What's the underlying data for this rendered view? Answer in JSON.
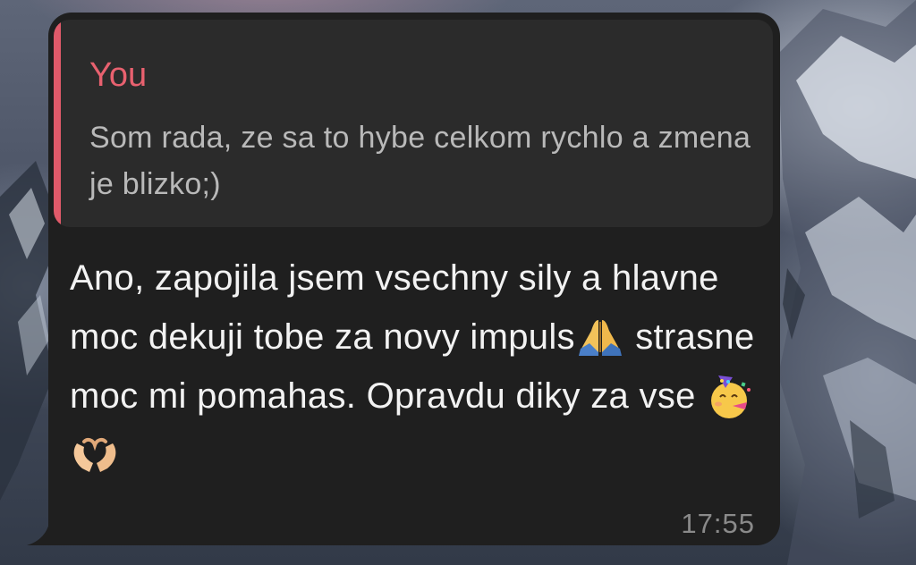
{
  "chat": {
    "reply": {
      "author": "You",
      "text": "Som rada, ze sa to hybe celkom rychlo a zmena je blizko;)"
    },
    "message": {
      "segments": [
        "Ano, zapojila jsem vsechny sily a hlavne moc dekuji tobe za novy impuls",
        " strasne moc mi pomahas. Opravdu diky za vse "
      ],
      "emoji": [
        "folded-hands",
        "partying-face",
        "heart-hands"
      ],
      "time": "17:55"
    }
  },
  "colors": {
    "bubble": "#1f1f1f",
    "reply_background": "#2b2b2b",
    "reply_accent": "#e05a6a",
    "text": "#f2f2f2",
    "timestamp": "#8a8a8a"
  }
}
